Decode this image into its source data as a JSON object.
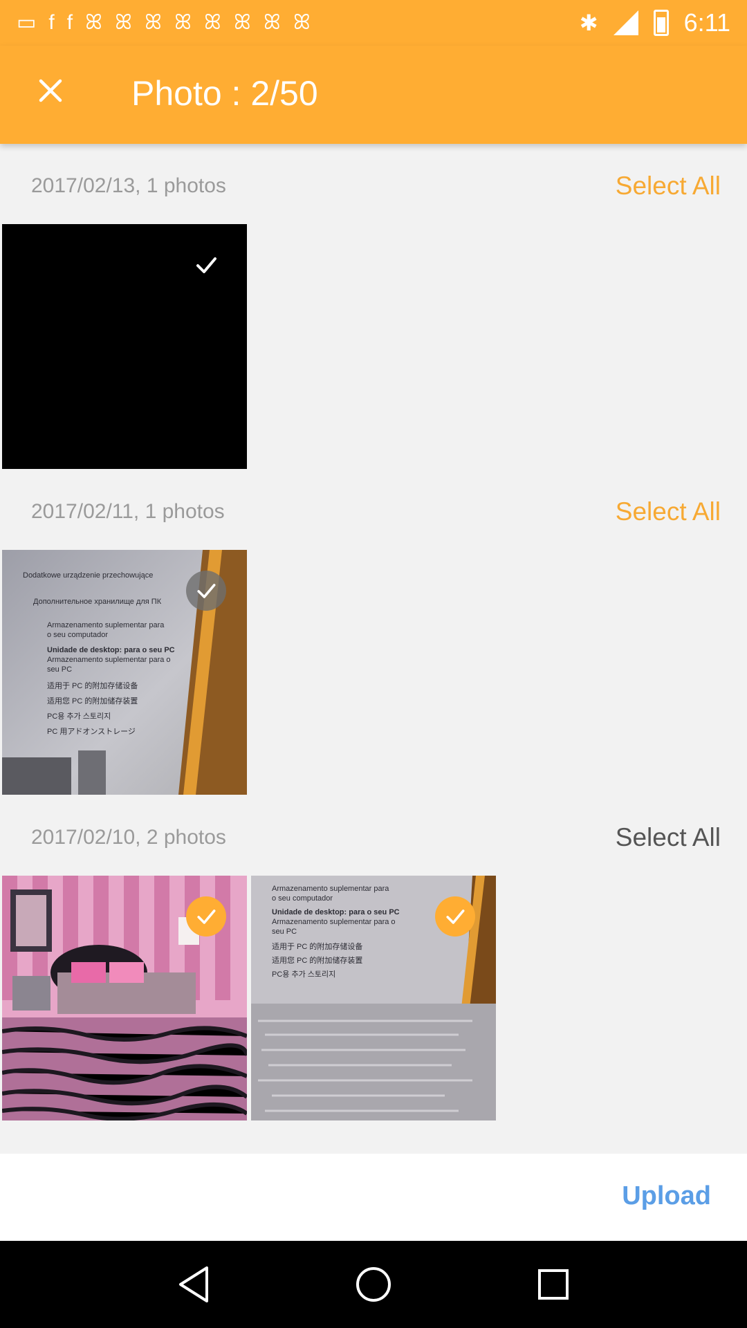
{
  "status_bar": {
    "time": "6:11",
    "icons": [
      "notification-icon",
      "facebook-icon",
      "facebook-icon",
      "notification-icon",
      "notification-icon",
      "notification-icon",
      "notification-icon",
      "notification-icon",
      "notification-icon",
      "notification-icon",
      "notification-icon"
    ]
  },
  "header": {
    "title": "Photo : 2/50",
    "close_icon": "close-icon"
  },
  "sections": [
    {
      "date": "2017/02/13, 1 photos",
      "select_all": "Select All",
      "photos": 1
    },
    {
      "date": "2017/02/11, 1 photos",
      "select_all": "Select All",
      "photos": 1
    },
    {
      "date": "2017/02/10, 2 photos",
      "select_all": "Select All",
      "photos": 2
    }
  ],
  "thumb_text_lines": [
    "Dodatkowe urządzenie przechowujące",
    "Дополнительное хранилище для ПК",
    "Armazenamento suplementar para",
    "o seu computador",
    "Unidade de desktop: para o seu PC",
    "Armazenamento suplementar para o",
    "seu PC",
    "适用于 PC 的附加存储设备",
    "适用您 PC 的附加储存装置",
    "PC용 추가 스토리지",
    "PC 用アドオンストレージ"
  ],
  "bottom": {
    "upload_label": "Upload"
  },
  "colors": {
    "accent": "#ffad33",
    "select_all": "#f7a933",
    "upload": "#5b9ee6"
  }
}
